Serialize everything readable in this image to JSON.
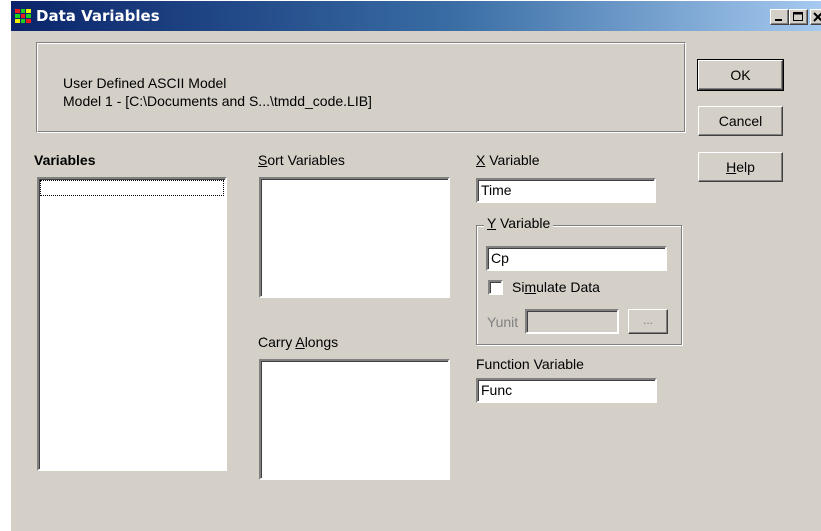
{
  "window": {
    "title": "Data Variables",
    "controls": {
      "minimize": "_",
      "maximize": "□",
      "close": "X"
    }
  },
  "info": {
    "line1": "User Defined ASCII Model",
    "line2": "Model 1  - [C:\\Documents and S...\\tmdd_code.LIB]"
  },
  "buttons": {
    "ok": "OK",
    "cancel": "Cancel",
    "help_prefix": "",
    "help_mnemonic": "H",
    "help_rest": "elp"
  },
  "variables": {
    "label": "Variables"
  },
  "sort_variables": {
    "mnemonic": "S",
    "rest": "ort Variables"
  },
  "carry_alongs": {
    "prefix": "Carry ",
    "mnemonic": "A",
    "rest": "longs"
  },
  "x_variable": {
    "mnemonic": "X",
    "rest": " Variable",
    "value": "Time"
  },
  "y_variable": {
    "mnemonic": "Y",
    "rest": " Variable",
    "value": "Cp",
    "simulate_prefix": "Si",
    "simulate_mnemonic": "m",
    "simulate_rest": "ulate Data",
    "simulate_checked": false,
    "yunit_label": "Yunit",
    "yunit_value": "",
    "browse_label": "..."
  },
  "function_variable": {
    "label": "Function Variable",
    "value": "Func"
  }
}
